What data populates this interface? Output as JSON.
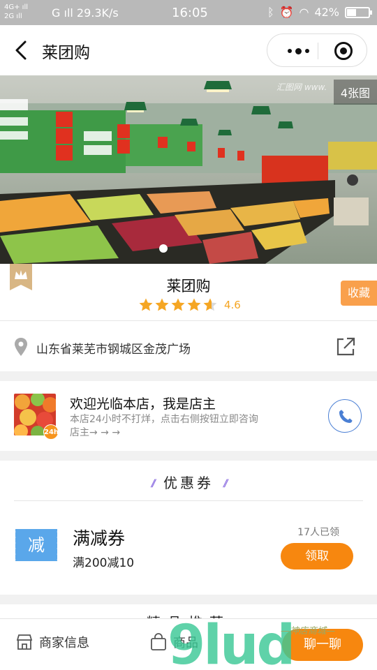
{
  "status_bar": {
    "network_left": "4G+",
    "network_left2": "2G",
    "network_g": "G",
    "speed": "29.3K/s",
    "time": "16:05",
    "battery": "42%",
    "battery_level": 0.42
  },
  "nav": {
    "title": "莱团购"
  },
  "banner": {
    "photo_count": "4张图",
    "watermark": "汇图网 www."
  },
  "store": {
    "name": "莱团购",
    "rating": "4.6",
    "rating_value": 4.6,
    "favorite_label": "收藏"
  },
  "address": {
    "text": "山东省莱芜市钢城区金茂广场"
  },
  "owner": {
    "badge": "24h",
    "title": "欢迎光临本店，我是店主",
    "desc": "本店24小时不打烊，点击右侧按钮立即咨询店主→ → →"
  },
  "coupons": {
    "section_title": "优惠券",
    "item": {
      "icon_label": "减",
      "title": "满减券",
      "subtitle": "满200减10",
      "claimed": "17人已领",
      "claim_label": "领取"
    }
  },
  "next_section": {
    "title": "精品推荐"
  },
  "bottom_bar": {
    "merchant_label": "商家信息",
    "goods_label": "商品",
    "chat_label": "聊一聊"
  },
  "watermark": {
    "logo": "9lud",
    "sub": "—神店商城—"
  },
  "colors": {
    "accent_orange": "#f7870f",
    "fav_orange": "#f9a04c",
    "star_yellow": "#f5a623",
    "call_blue": "#4a7fd4",
    "coupon_blue": "#5aa7ea"
  }
}
